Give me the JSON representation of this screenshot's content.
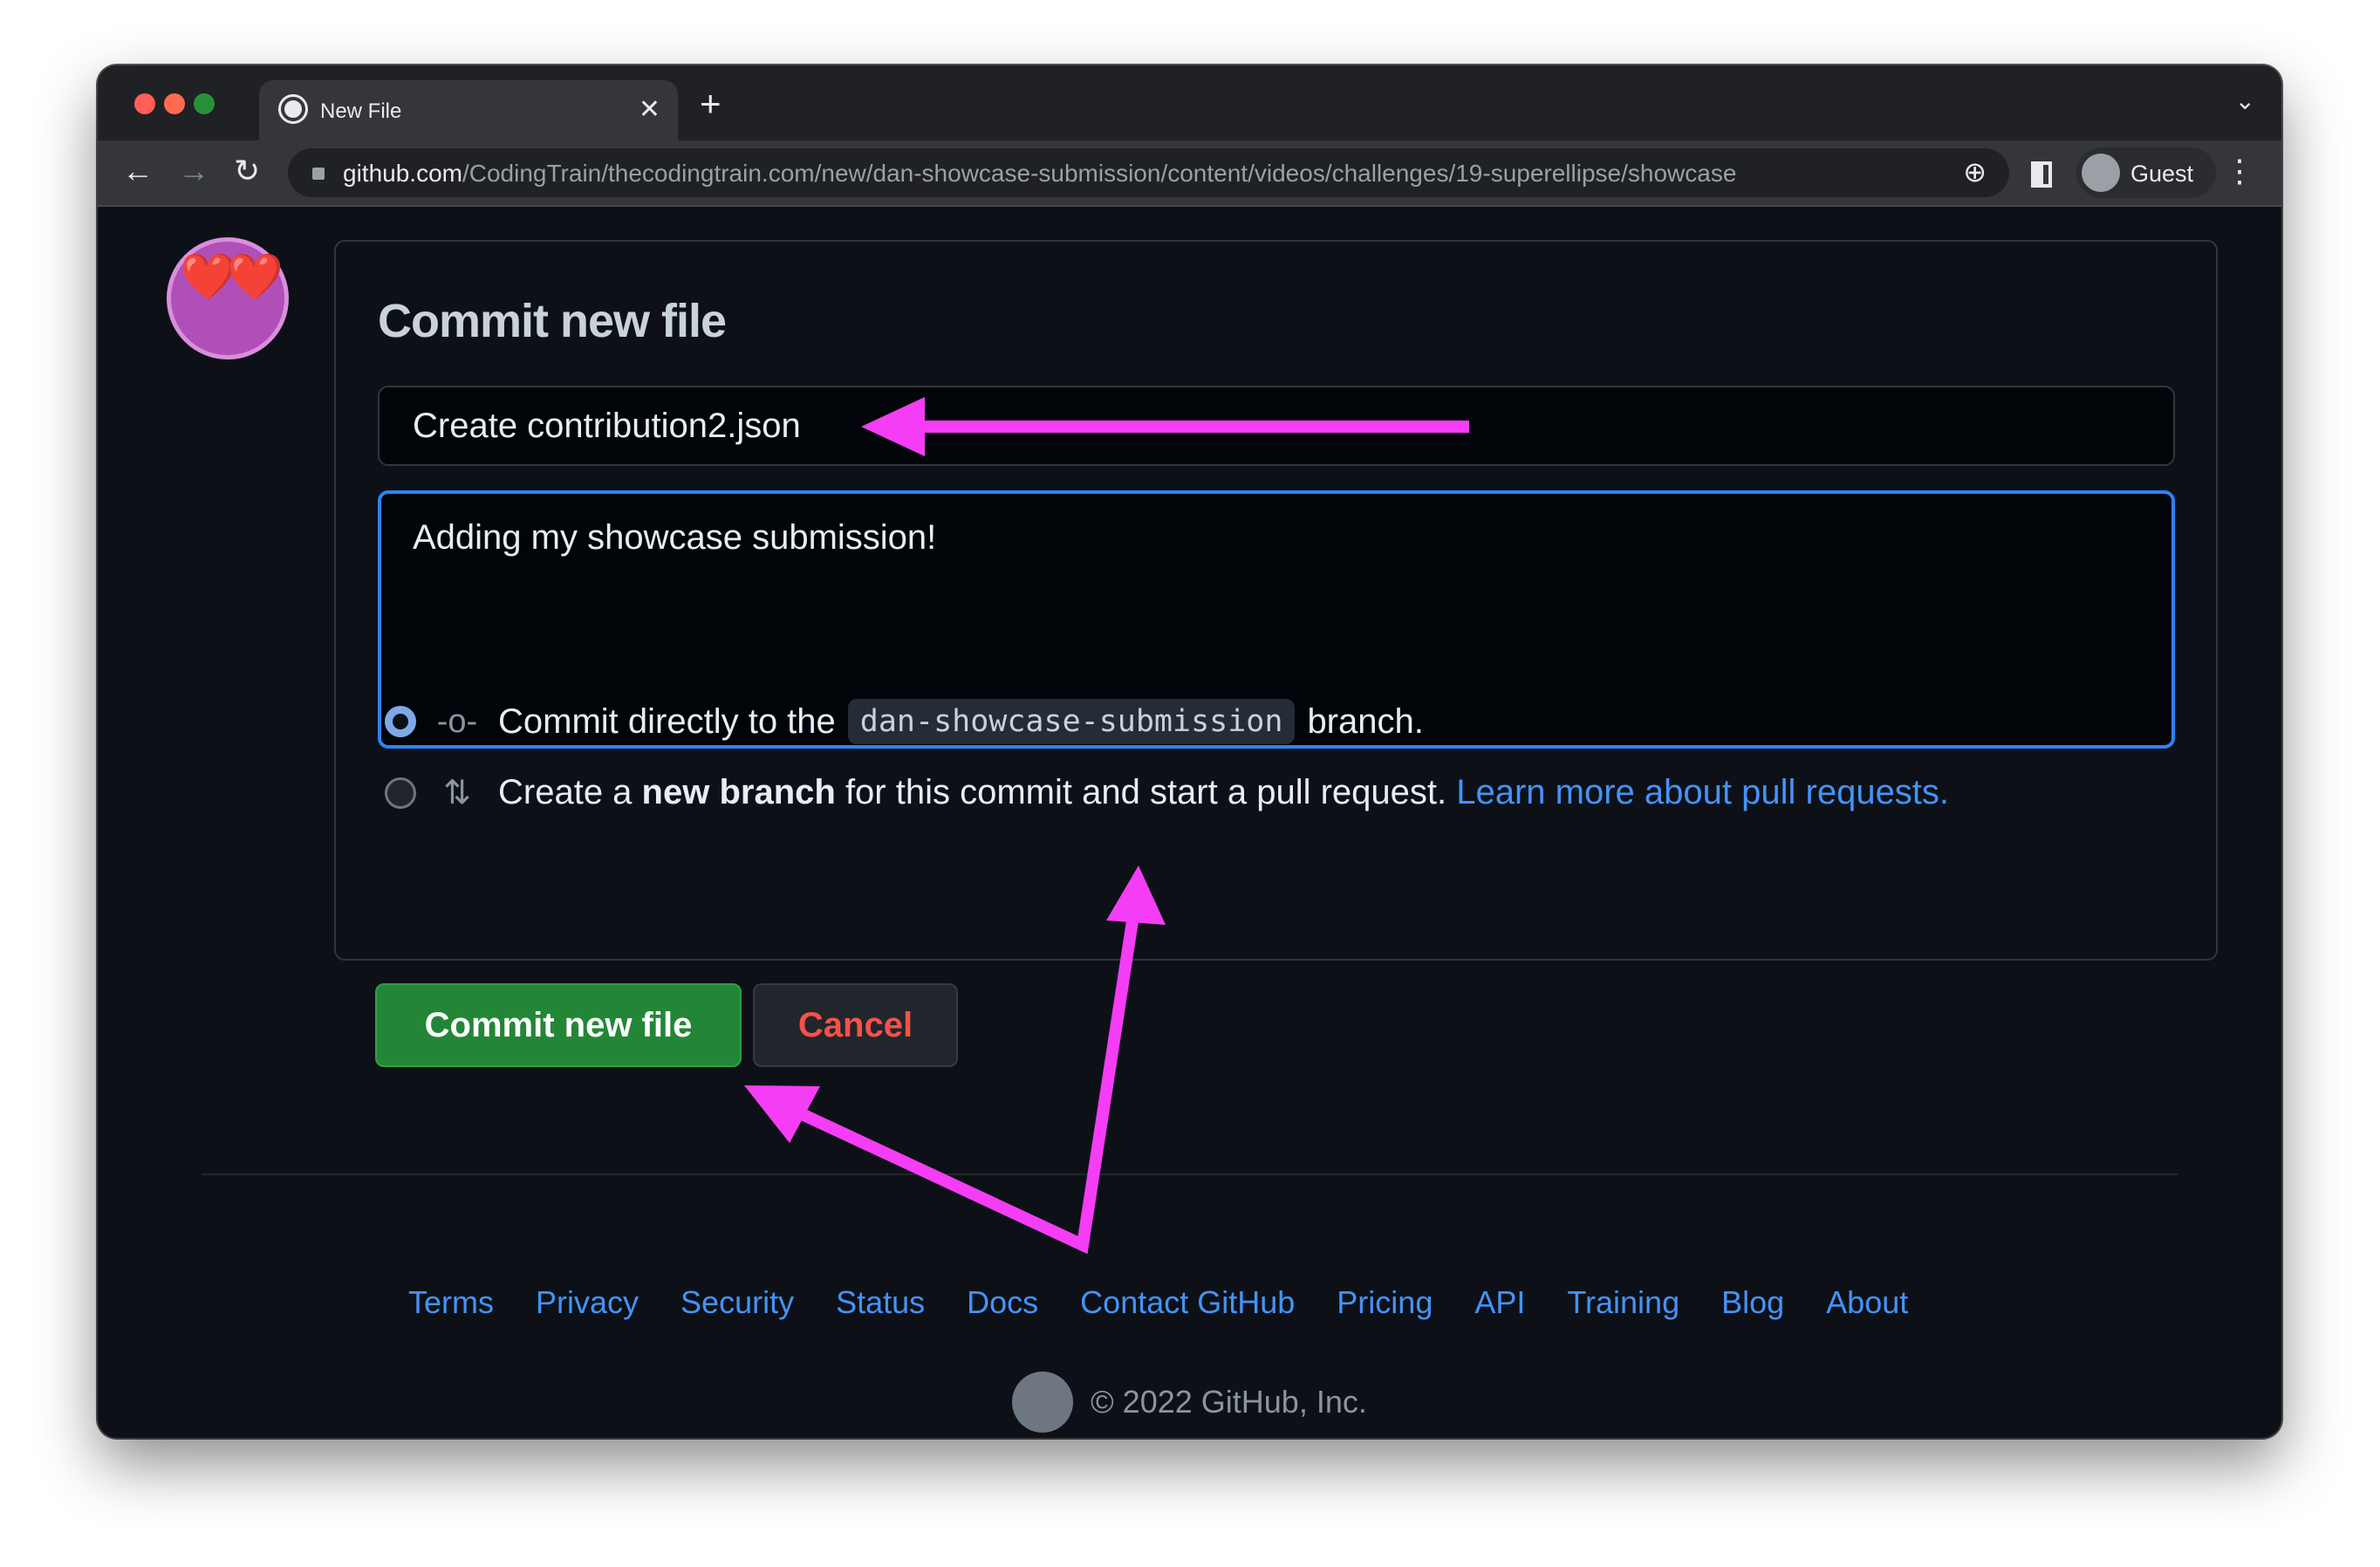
{
  "browser": {
    "tab_title": "New File",
    "url_domain": "github.com",
    "url_path": "/CodingTrain/thecodingtrain.com/new/dan-showcase-submission/content/videos/challenges/19-superellipse/showcase",
    "profile": "Guest"
  },
  "form": {
    "title": "Commit new file",
    "summary_value": "Create contribution2.json",
    "description_value": "Adding my showcase submission!",
    "option1": {
      "prefix": "Commit directly to the",
      "branch": "dan-showcase-submission",
      "suffix": "branch.",
      "selected": true
    },
    "option2": {
      "prefix": "Create a",
      "bold": "new branch",
      "suffix": "for this commit and start a pull request.",
      "link": "Learn more about pull requests.",
      "selected": false
    },
    "commit_button": "Commit new file",
    "cancel_button": "Cancel"
  },
  "footer": {
    "links": [
      "Terms",
      "Privacy",
      "Security",
      "Status",
      "Docs",
      "Contact GitHub",
      "Pricing",
      "API",
      "Training",
      "Blog",
      "About"
    ],
    "copyright": "© 2022 GitHub, Inc."
  },
  "colors": {
    "annotation_arrow": "#f53df5",
    "commit_green": "#238636",
    "cancel_red": "#f85149",
    "link": "#4493f8"
  }
}
